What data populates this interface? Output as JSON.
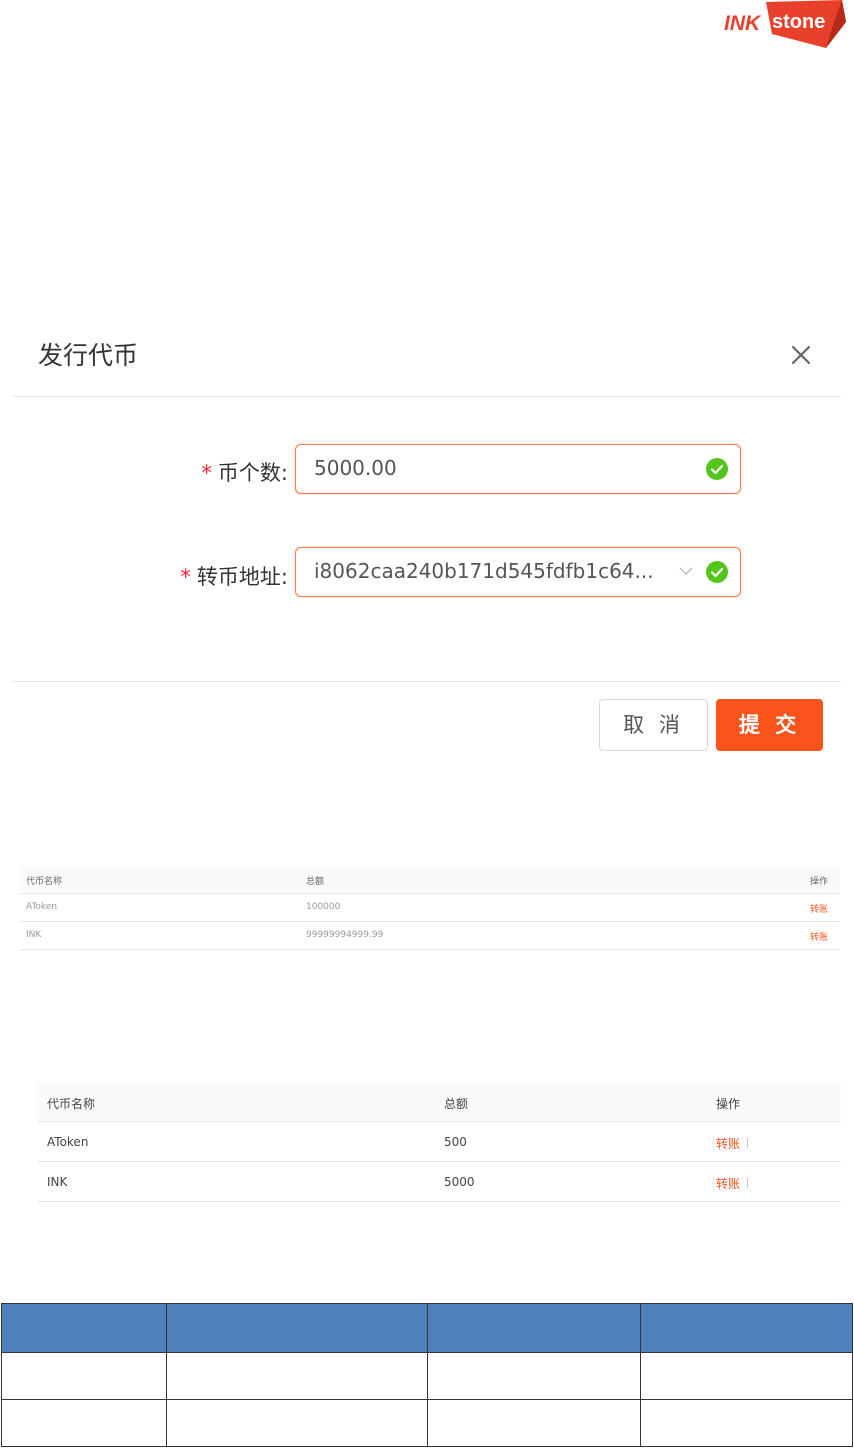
{
  "logo": {
    "text": "INKstone",
    "brand_color": "#e8402a"
  },
  "modal": {
    "title": "发行代币",
    "close_icon": "close-icon",
    "fields": [
      {
        "label": "币个数:",
        "value": "5000.00",
        "status": "valid"
      },
      {
        "label": "转币地址:",
        "value": "i8062caa240b171d545fdfb1c64...",
        "status": "valid",
        "type": "select"
      }
    ],
    "cancel_label": "取 消",
    "submit_label": "提 交",
    "accent_color": "#fa541c"
  },
  "table_small": {
    "headers": [
      "代币名称",
      "总额",
      "操作"
    ],
    "rows": [
      {
        "name": "AToken",
        "total": "100000",
        "action": "转账"
      },
      {
        "name": "INK",
        "total": "99999994999.99",
        "action": "转账"
      }
    ]
  },
  "table_medium": {
    "headers": [
      "代币名称",
      "总额",
      "操作"
    ],
    "rows": [
      {
        "name": "AToken",
        "total": "500",
        "action": "转账"
      },
      {
        "name": "INK",
        "total": "5000",
        "action": "转账"
      }
    ]
  },
  "table_blue": {
    "header_color": "#4f81bd",
    "rows": 2,
    "cols": 4
  }
}
